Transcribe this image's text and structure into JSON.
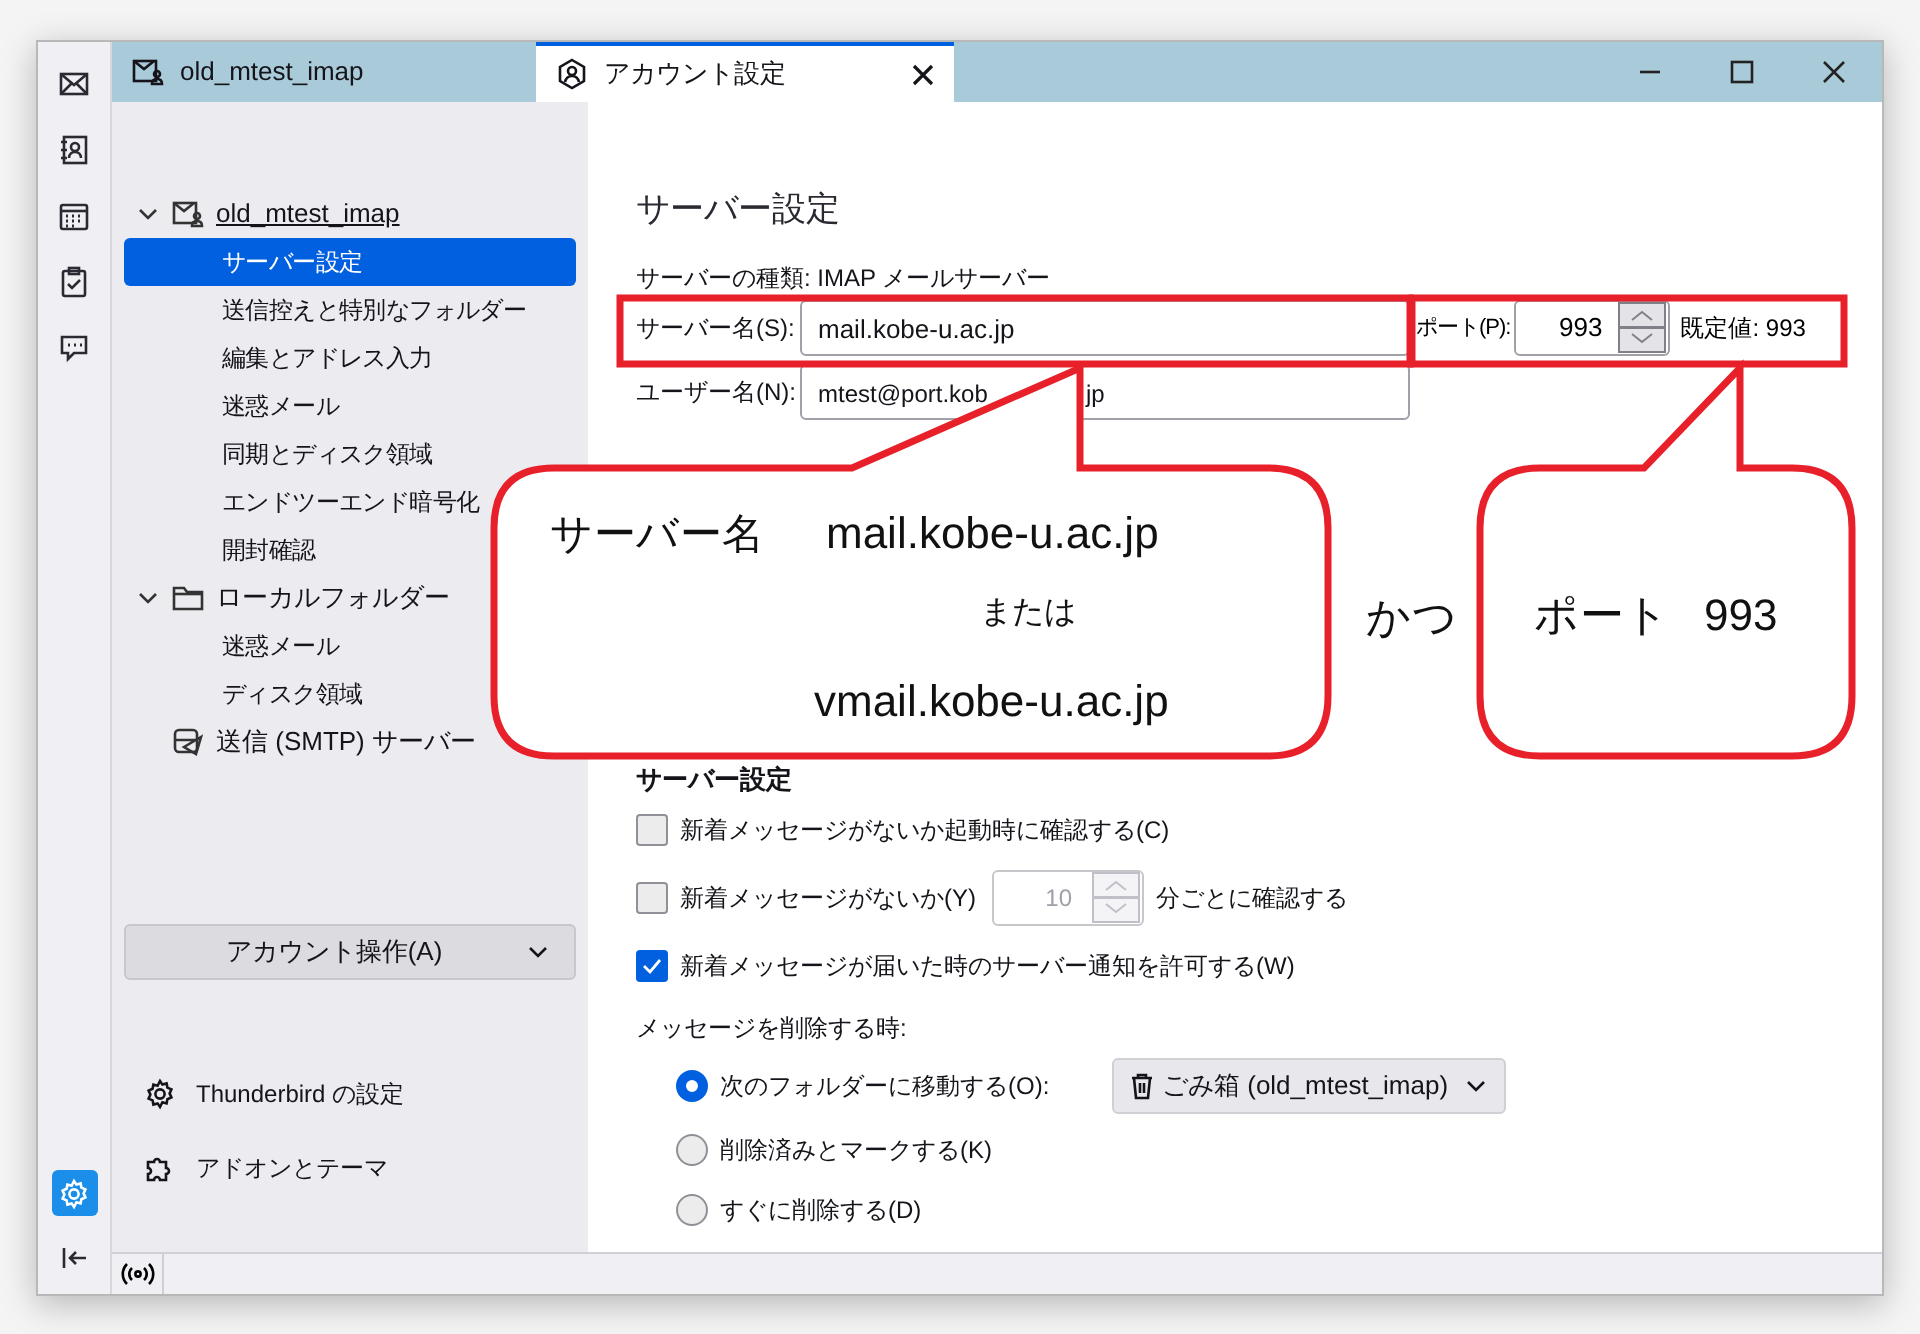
{
  "window": {
    "tabs": [
      {
        "label": "old_mtest_imap",
        "selected": false
      },
      {
        "label": "アカウント設定",
        "selected": true
      }
    ]
  },
  "rail": {
    "apps": [
      {
        "selected": false
      },
      {
        "selected": false
      },
      {
        "selected": false
      },
      {
        "selected": false
      },
      {
        "selected": false
      }
    ],
    "settings": {
      "selected": true
    }
  },
  "sidebar": {
    "tree": [
      {
        "label": "old_mtest_imap",
        "kind": "account",
        "expanded": true,
        "children": [
          {
            "label": "サーバー設定",
            "selected": true
          },
          {
            "label": "送信控えと特別なフォルダー",
            "selected": false
          },
          {
            "label": "編集とアドレス入力",
            "selected": false
          },
          {
            "label": "迷惑メール",
            "selected": false
          },
          {
            "label": "同期とディスク領域",
            "selected": false
          },
          {
            "label": "エンドツーエンド暗号化",
            "selected": false
          },
          {
            "label": "開封確認",
            "selected": false
          }
        ]
      },
      {
        "label": "ローカルフォルダー",
        "kind": "folder",
        "expanded": true,
        "children": [
          {
            "label": "迷惑メール",
            "selected": false
          },
          {
            "label": "ディスク領域",
            "selected": false
          }
        ]
      },
      {
        "label": "送信 (SMTP) サーバー",
        "kind": "smtp"
      }
    ],
    "account_actions": "アカウント操作(A)",
    "footer": [
      "Thunderbird の設定",
      "アドオンとテーマ"
    ]
  },
  "content": {
    "title": "サーバー設定",
    "server_type": "サーバーの種類: IMAP メールサーバー",
    "server_name": {
      "label": "サーバー名(S):",
      "value": "mail.kobe-u.ac.jp"
    },
    "port": {
      "label": "ポート(P):",
      "value": "993",
      "default": "既定値: 993"
    },
    "user_name": {
      "label": "ユーザー名(N):",
      "value": "mtest@port.kob",
      "value_tail": "jp"
    },
    "server_settings": {
      "title": "サーバー設定",
      "options": [
        {
          "kind": "checkbox",
          "label": "新着メッセージがないか起動時に確認する(C)",
          "checked": false
        },
        {
          "kind": "interval",
          "label": "新着メッセージがないか(Y)",
          "checked": false,
          "value": "10",
          "suffix": "分ごとに確認する"
        },
        {
          "kind": "checkbox",
          "label": "新着メッセージが届いた時のサーバー通知を許可する(W)",
          "checked": true
        }
      ],
      "delete_label": "メッセージを削除する時:",
      "delete_options": [
        {
          "label": "次のフォルダーに移動する(O):",
          "selected": true,
          "folder": "ごみ箱 (old_mtest_imap)"
        },
        {
          "label": "削除済みとマークする(K)",
          "selected": false
        },
        {
          "label": "すぐに削除する(D)",
          "selected": false
        }
      ]
    }
  },
  "annotations": {
    "left_callout": [
      "サーバー名",
      "mail.kobe-u.ac.jp",
      "または",
      "vmail.kobe-u.ac.jp"
    ],
    "connector": "かつ",
    "right_callout": [
      "ポート",
      "993"
    ]
  }
}
